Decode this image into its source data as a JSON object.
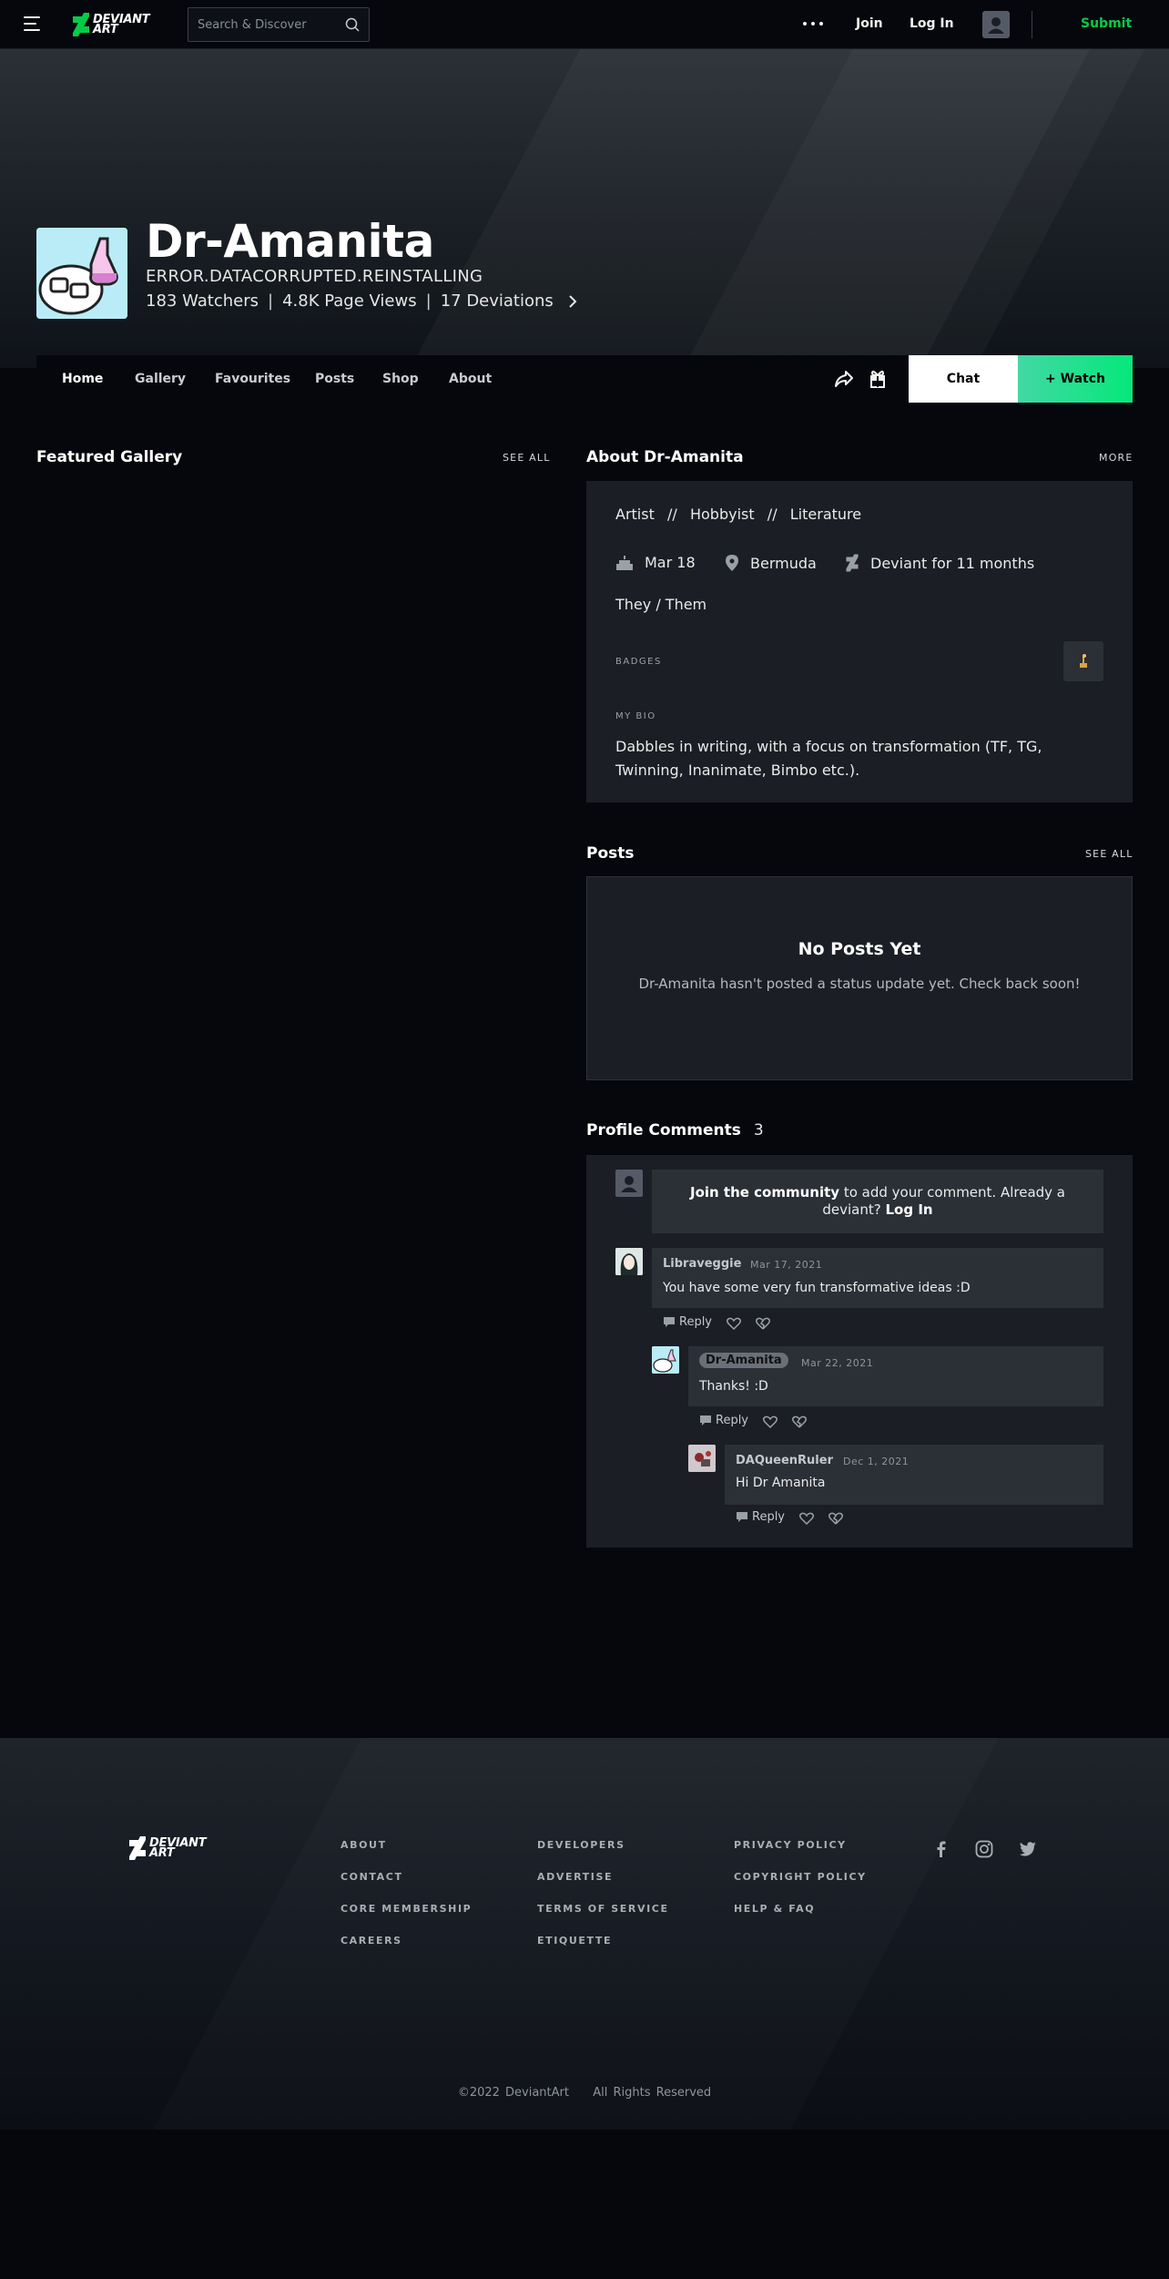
{
  "header": {
    "brand": "DEVIANT ART",
    "search_placeholder": "Search & Discover",
    "join": "Join",
    "login": "Log In",
    "submit": "Submit"
  },
  "profile": {
    "username": "Dr-Amanita",
    "tagline": "ERROR.DATACORRUPTED.REINSTALLING",
    "watchers": "183 Watchers",
    "page_views": "4.8K Page Views",
    "deviations": "17 Deviations",
    "separator": "|"
  },
  "nav": {
    "tabs": [
      "Home",
      "Gallery",
      "Favourites",
      "Posts",
      "Shop",
      "About"
    ],
    "chat": "Chat",
    "watch": "+ Watch"
  },
  "featured": {
    "title": "Featured Gallery",
    "see_all": "SEE ALL"
  },
  "about": {
    "title": "About Dr-Amanita",
    "more": "MORE",
    "roles": "Artist  //  Hobbyist  //  Literature",
    "birthday": "Mar 18",
    "location": "Bermuda",
    "deviant_for": "Deviant for 11 months",
    "pronouns": "They / Them",
    "badges_label": "BADGES",
    "bio_label": "MY BIO",
    "bio": "Dabbles in writing, with a focus on transformation (TF, TG, Twinning, Inanimate, Bimbo etc.)."
  },
  "posts": {
    "title": "Posts",
    "see_all": "SEE ALL",
    "empty_title": "No Posts Yet",
    "empty_text": "Dr-Amanita hasn't posted a status update yet. Check back soon!"
  },
  "comments": {
    "title": "Profile Comments",
    "count": "3",
    "join_bold": "Join the community",
    "join_text": " to add your comment. Already a deviant? ",
    "join_login": "Log In",
    "reply_label": "Reply",
    "items": [
      {
        "author": "Libraveggie",
        "date": "Mar 17, 2021",
        "text": "You have some very fun transformative ideas :D"
      },
      {
        "author": "Dr-Amanita",
        "date": "Mar 22, 2021",
        "text": "Thanks! :D"
      },
      {
        "author": "DAQueenRuler",
        "date": "Dec 1, 2021",
        "text": "Hi Dr Amanita"
      }
    ]
  },
  "footer": {
    "brand": "DEVIANT ART",
    "col1": [
      "ABOUT",
      "CONTACT",
      "CORE MEMBERSHIP",
      "CAREERS"
    ],
    "col2": [
      "DEVELOPERS",
      "ADVERTISE",
      "TERMS OF SERVICE",
      "ETIQUETTE"
    ],
    "col3": [
      "PRIVACY POLICY",
      "COPYRIGHT POLICY",
      "HELP & FAQ"
    ],
    "social_icons": [
      "facebook-icon",
      "instagram-icon",
      "twitter-icon"
    ],
    "copyright": "©2022 DeviantArt",
    "rights": "All Rights Reserved"
  },
  "colors": {
    "accent": "#05cc47",
    "background": "#06070d",
    "card": "#1b1e24"
  }
}
